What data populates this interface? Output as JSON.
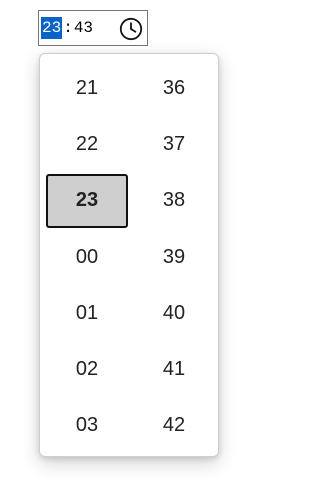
{
  "time_input": {
    "hours": "23",
    "separator": ":",
    "minutes": "43",
    "clock_icon": "clock-icon"
  },
  "picker": {
    "hours": [
      "21",
      "22",
      "23",
      "00",
      "01",
      "02",
      "03"
    ],
    "minutes": [
      "36",
      "37",
      "38",
      "39",
      "40",
      "41",
      "42"
    ],
    "selected_hour": "23"
  },
  "colors": {
    "selection_highlight": "#0a64c8",
    "selected_cell_bg": "#cfcfcf",
    "selected_cell_border": "#111111"
  }
}
